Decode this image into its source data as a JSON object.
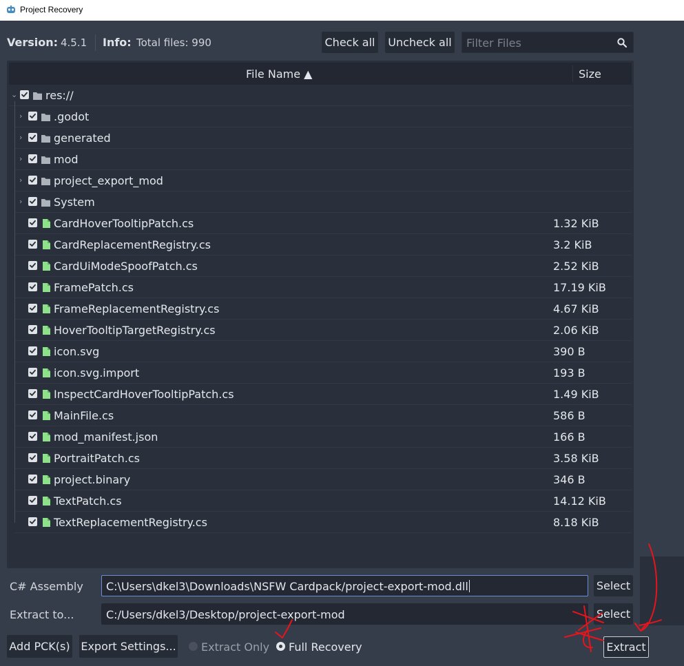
{
  "window": {
    "title": "Project Recovery",
    "app_icon": "godot-icon"
  },
  "topbar": {
    "version_label": "Version:",
    "version_value": "4.5.1",
    "info_label": "Info:",
    "info_value": "Total files: 990",
    "check_all": "Check all",
    "uncheck_all": "Uncheck all",
    "filter_placeholder": "Filter Files"
  },
  "tree": {
    "col_name": "File Name ▲",
    "col_size": "Size",
    "root": {
      "name": "res://",
      "expanded": true,
      "checked": true
    },
    "folders": [
      {
        "name": ".godot",
        "checked": true
      },
      {
        "name": "generated",
        "checked": true
      },
      {
        "name": "mod",
        "checked": true
      },
      {
        "name": "project_export_mod",
        "checked": true
      },
      {
        "name": "System",
        "checked": true
      }
    ],
    "files": [
      {
        "name": "CardHoverTooltipPatch.cs",
        "size": "1.32 KiB"
      },
      {
        "name": "CardReplacementRegistry.cs",
        "size": "3.2 KiB"
      },
      {
        "name": "CardUiModeSpoofPatch.cs",
        "size": "2.52 KiB"
      },
      {
        "name": "FramePatch.cs",
        "size": "17.19 KiB"
      },
      {
        "name": "FrameReplacementRegistry.cs",
        "size": "4.67 KiB"
      },
      {
        "name": "HoverTooltipTargetRegistry.cs",
        "size": "2.06 KiB"
      },
      {
        "name": "icon.svg",
        "size": "390 B"
      },
      {
        "name": "icon.svg.import",
        "size": "193 B"
      },
      {
        "name": "InspectCardHoverTooltipPatch.cs",
        "size": "1.49 KiB"
      },
      {
        "name": "MainFile.cs",
        "size": "586 B"
      },
      {
        "name": "mod_manifest.json",
        "size": "166 B"
      },
      {
        "name": "PortraitPatch.cs",
        "size": "3.58 KiB"
      },
      {
        "name": "project.binary",
        "size": "346 B"
      },
      {
        "name": "TextPatch.cs",
        "size": "14.12 KiB"
      },
      {
        "name": "TextReplacementRegistry.cs",
        "size": "8.18 KiB"
      }
    ]
  },
  "bottom": {
    "assembly_label": "C# Assembly",
    "assembly_value": "C:\\Users\\dkel3\\Downloads\\NSFW Cardpack/project-export-mod.dll",
    "extract_label": "Extract to...",
    "extract_value": "C:/Users/dkel3/Desktop/project-export-mod",
    "select": "Select",
    "add_pck": "Add PCK(s)",
    "export_settings": "Export Settings...",
    "extract_only": "Extract Only",
    "full_recovery": "Full Recovery",
    "extract": "Extract",
    "mode_selected": "full_recovery"
  },
  "colors": {
    "folder": "#aeb3bb",
    "file": "#8fe08a",
    "annotation": "#e8141c",
    "focus": "#6b8fd6"
  }
}
